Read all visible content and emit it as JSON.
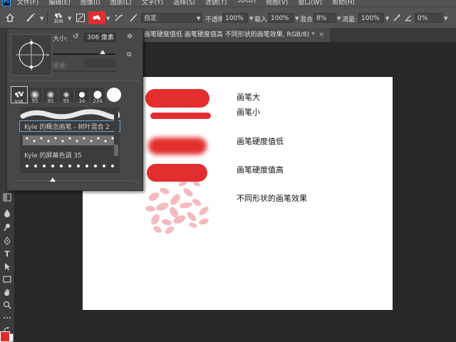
{
  "menubar": {
    "logo": "Ps",
    "items": [
      "文件(F)",
      "编辑(E)",
      "图像(I)",
      "图层(L)",
      "文字(Y)",
      "选择(S)",
      "滤镜(T)",
      "3D(D)",
      "视图(V)",
      "窗口(W)",
      "帮助(H)"
    ]
  },
  "options": {
    "brush_size": "306",
    "mode_value": "自定",
    "opacity_label": "不透明度:",
    "opacity_value": "100%",
    "flow_label": "载入:",
    "flow_value": "100%",
    "mix_label": "混合:",
    "mix_value": "8%",
    "flow2_label": "流量:",
    "flow2_value": "100%",
    "angle_value": "0%"
  },
  "document_tab": {
    "title": "画笔硬度值低 画笔硬度值高 不同形状的画笔效果, RGB/8) *",
    "close": "×"
  },
  "brush_panel": {
    "size_label": "大小:",
    "size_value": "306 像素",
    "hardness_label": "硬度:",
    "presets": [
      {
        "num": "306"
      },
      {
        "num": "95"
      },
      {
        "num": "95"
      },
      {
        "num": "95"
      },
      {
        "num": "34"
      },
      {
        "num": "234"
      }
    ],
    "list_items": [
      {
        "label": "Kyle 的概念画笔 - 树叶混合 2"
      },
      {
        "label": "Kyle 的屏幕色调 35"
      }
    ]
  },
  "canvas": {
    "labels": [
      "画笔大",
      "画笔小",
      "画笔硬度值低",
      "画笔硬度值高",
      "不同形状的画笔效果"
    ],
    "stroke_color": "#e32d2f"
  },
  "colors": {
    "foreground": "#e0292c",
    "background": "#ffffff"
  }
}
